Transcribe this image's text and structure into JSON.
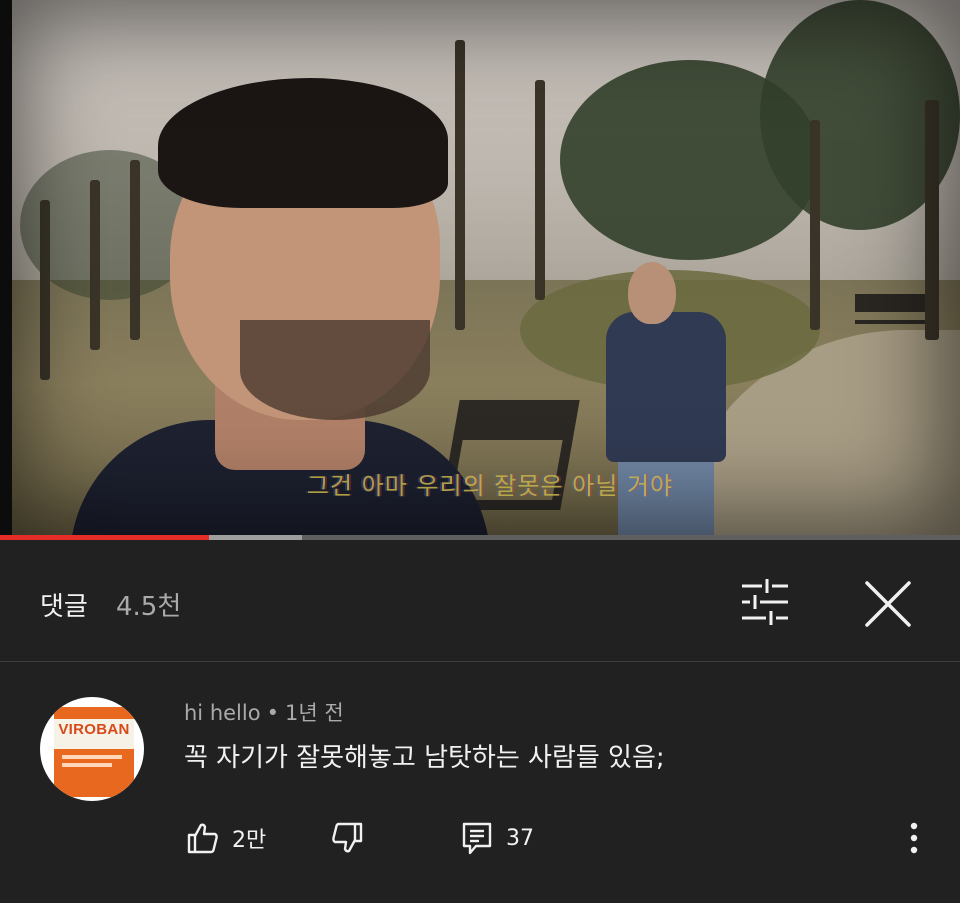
{
  "video": {
    "subtitle": "그건 아마 우리의 잘못은 아닐 거야",
    "progress": {
      "played_fraction": 0.218,
      "buffered_fraction": 0.315
    }
  },
  "comments_header": {
    "title": "댓글",
    "count": "4.5천",
    "filter_icon": "sort-sliders-icon",
    "close_icon": "close-icon"
  },
  "comment": {
    "avatar_brand": "VIROBAN",
    "author": "hi hello",
    "separator": "•",
    "time": "1년 전",
    "text": "꼭 자기가 잘못해놓고 남탓하는 사람들 있음;",
    "likes": "2만",
    "replies": "37",
    "icons": {
      "like": "thumbs-up-icon",
      "dislike": "thumbs-down-icon",
      "reply": "reply-comment-icon",
      "more": "more-vertical-icon"
    }
  },
  "colors": {
    "background": "#212121",
    "text_primary": "#f1f1f1",
    "text_secondary": "#aaaaaa",
    "progress_played": "#e52d27",
    "subtitle": "#c7b64a"
  }
}
